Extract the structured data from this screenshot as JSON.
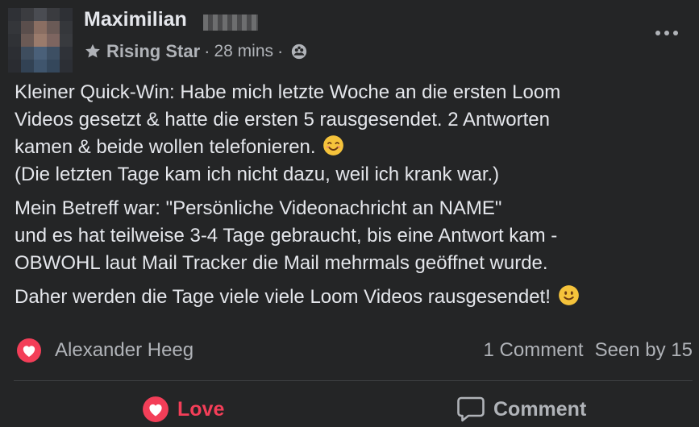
{
  "post": {
    "author": "Maximilian",
    "badge": "Rising Star",
    "separator": "·",
    "time": "28 mins",
    "paragraphs": [
      [
        "Kleiner Quick-Win: Habe mich letzte Woche an die ersten Loom",
        "Videos gesetzt & hatte die ersten 5 rausgesendet. 2 Antworten",
        "kamen & beide wollen telefonieren.",
        "(Die letzten Tage kam ich nicht dazu, weil ich krank war.)"
      ],
      [
        "Mein Betreff war: \"Persönliche Videonachricht an NAME\"",
        "und es hat teilweise 3-4 Tage gebraucht, bis eine Antwort kam -",
        "OBWOHL laut Mail Tracker die Mail mehrmals geöffnet wurde."
      ],
      [
        "Daher werden die Tage viele viele Loom Videos rausgesendet!"
      ]
    ]
  },
  "reactions": {
    "reactor": "Alexander Heeg",
    "comments": "1 Comment",
    "seen": "Seen by 15"
  },
  "actions": {
    "love": "Love",
    "comment": "Comment"
  },
  "colors": {
    "background": "#242526",
    "text": "#e4e6eb",
    "muted": "#b0b3b8",
    "love": "#f33e58"
  }
}
